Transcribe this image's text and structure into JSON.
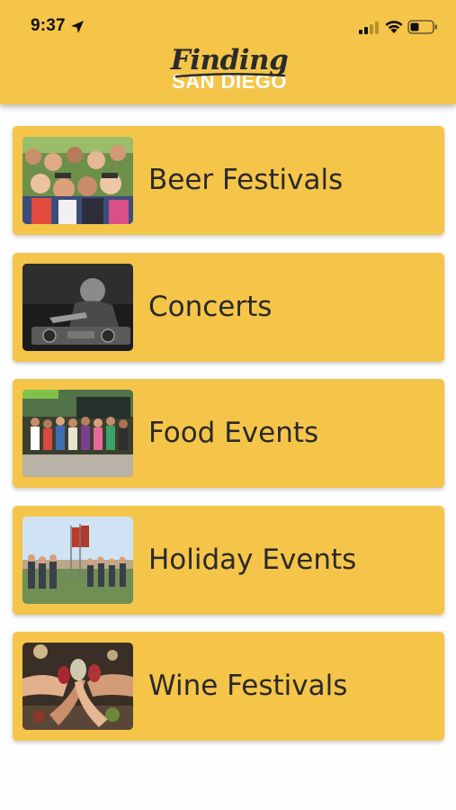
{
  "status_bar": {
    "time": "9:37"
  },
  "header": {
    "logo_line1": "Finding",
    "logo_line2": "SAN DIEGO",
    "background_color": "#f5c54a"
  },
  "categories": [
    {
      "label": "Beer Festivals",
      "image": "beer-festival-crowd-photo"
    },
    {
      "label": "Concerts",
      "image": "dj-concert-photo"
    },
    {
      "label": "Food Events",
      "image": "food-event-group-photo"
    },
    {
      "label": "Holiday Events",
      "image": "holiday-parade-photo"
    },
    {
      "label": "Wine Festivals",
      "image": "wine-toast-photo"
    }
  ],
  "colors": {
    "card": "#f5c54a",
    "text": "#2a2a2a",
    "page": "#fefefe"
  }
}
